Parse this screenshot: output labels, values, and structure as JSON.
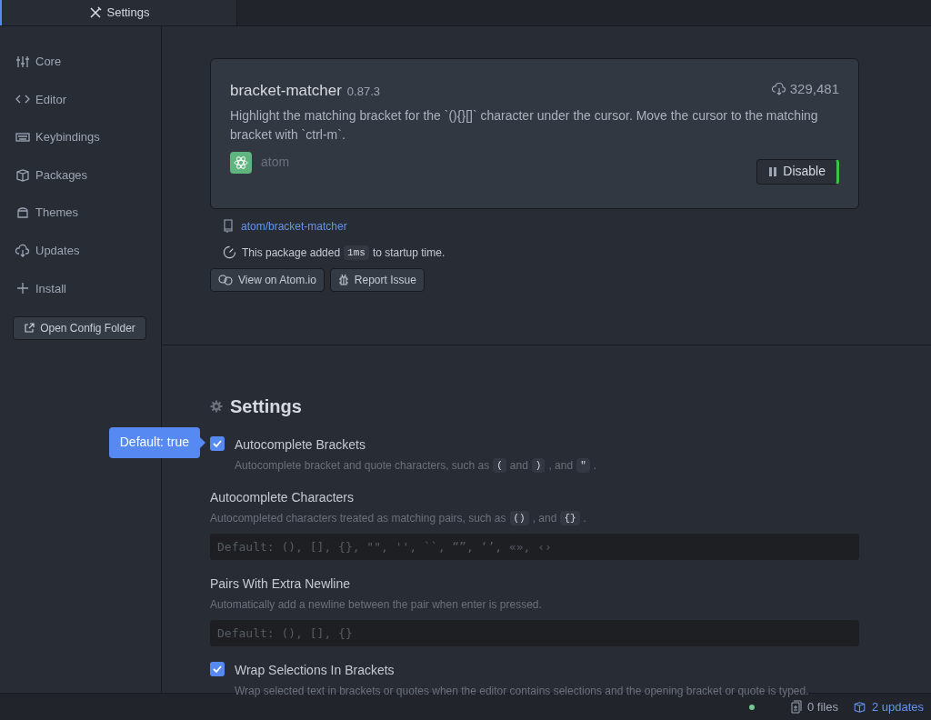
{
  "tabs": [
    {
      "label": "Settings",
      "selected": true
    }
  ],
  "sidebar": {
    "items": [
      {
        "label": "Core",
        "selected": false
      },
      {
        "label": "Editor",
        "selected": false
      },
      {
        "label": "Keybindings",
        "selected": false
      },
      {
        "label": "Packages",
        "selected": false
      },
      {
        "label": "Themes",
        "selected": false
      },
      {
        "label": "Updates",
        "selected": false
      },
      {
        "label": "Install",
        "selected": false
      }
    ],
    "button": "Open Config Folder"
  },
  "package": {
    "name": "bracket-matcher",
    "version": "0.87.3",
    "downloads": "329,481",
    "description": "Highlight the matching bracket for the `(){}[]` character under the cursor. Move the cursor to the matching bracket with `ctrl-m`.",
    "author": "atom",
    "toggle": {
      "label": "Disable",
      "enabled": true
    },
    "repo": "atom/bracket-matcher",
    "startup": [
      {
        "kind": "text",
        "text": "This package added"
      },
      {
        "kind": "code",
        "text": "1ms"
      },
      {
        "kind": "text",
        "text": "to startup time."
      }
    ],
    "buttons": [
      {
        "label": "View on Atom.io"
      },
      {
        "label": "Report Issue"
      }
    ]
  },
  "settings": {
    "title": "Settings",
    "tooltip": "Default: true",
    "items": [
      {
        "kind": "checkbox",
        "label": "Autocomplete Brackets",
        "checked": true,
        "description": [
          {
            "kind": "text",
            "text": "Autocomplete bracket and quote characters, such as"
          },
          {
            "kind": "code",
            "text": "("
          },
          {
            "kind": "text",
            "text": "and"
          },
          {
            "kind": "code",
            "text": ")"
          },
          {
            "kind": "text",
            "text": ", and"
          },
          {
            "kind": "code",
            "text": "\""
          },
          {
            "kind": "text",
            "text": "."
          }
        ]
      },
      {
        "kind": "field",
        "label": "Autocomplete Characters",
        "placeholder": "Default: (), [], {}, \"\", '', ``, “”, ‘’, «», ‹›",
        "description": [
          {
            "kind": "text",
            "text": "Autocompleted characters treated as matching pairs, such as"
          },
          {
            "kind": "code",
            "text": "()"
          },
          {
            "kind": "text",
            "text": ", and"
          },
          {
            "kind": "code",
            "text": "{}"
          },
          {
            "kind": "text",
            "text": "."
          }
        ]
      },
      {
        "kind": "field",
        "label": "Pairs With Extra Newline",
        "placeholder": "Default: (), [], {}",
        "description": [
          {
            "kind": "text",
            "text": "Automatically add a newline between the pair when enter is pressed."
          }
        ]
      },
      {
        "kind": "checkbox",
        "label": "Wrap Selections In Brackets",
        "checked": true,
        "description": [
          {
            "kind": "text",
            "text": "Wrap selected text in brackets or quotes when the editor contains selections and the opening bracket or quote is typed."
          }
        ]
      }
    ]
  },
  "status_bar": {
    "files": "0 files",
    "updates": "2 updates"
  }
}
